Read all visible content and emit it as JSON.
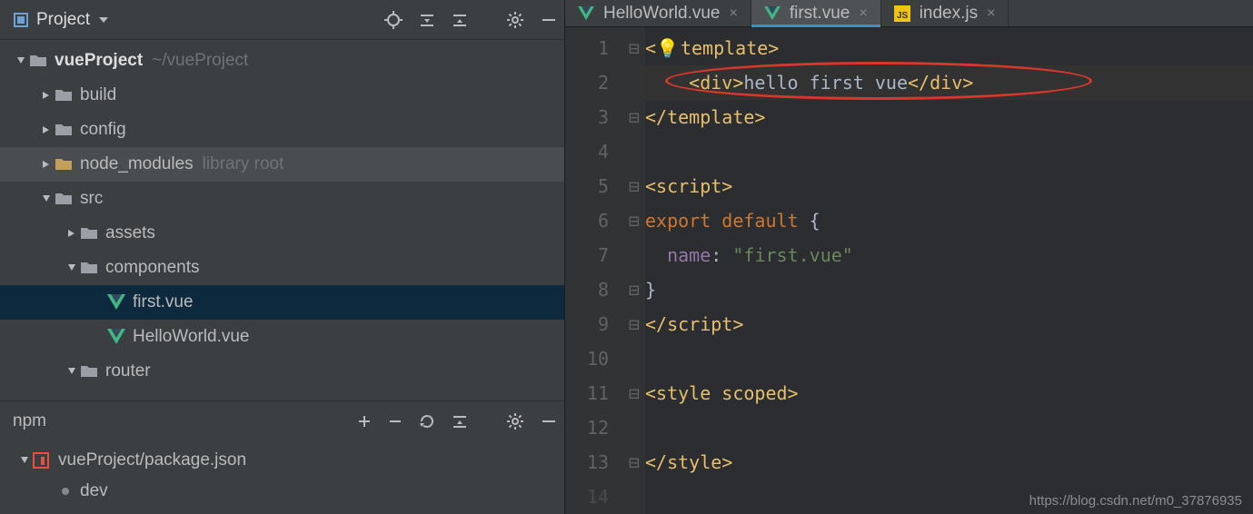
{
  "sidebar": {
    "title": "Project",
    "tree": {
      "root": {
        "name": "vueProject",
        "path": "~/vueProject"
      },
      "build": "build",
      "config": "config",
      "node_modules": {
        "name": "node_modules",
        "hint": "library root"
      },
      "src": "src",
      "assets": "assets",
      "components": "components",
      "first": "first.vue",
      "hello": "HelloWorld.vue",
      "router": "router"
    }
  },
  "npm": {
    "title": "npm",
    "package": "vueProject/package.json",
    "script": "dev"
  },
  "tabs": [
    {
      "label": "HelloWorld.vue",
      "type": "vue",
      "active": false
    },
    {
      "label": "first.vue",
      "type": "vue",
      "active": true
    },
    {
      "label": "index.js",
      "type": "js",
      "active": false
    }
  ],
  "code": {
    "line1": "template",
    "line2_open": "div",
    "line2_text": "hello first vue",
    "line2_close": "div",
    "line3": "template",
    "line5": "script",
    "line6a": "export ",
    "line6b": "default ",
    "line7_key": "name",
    "line7_val": "\"first.vue\"",
    "line9": "script",
    "line11": "style scoped",
    "line13": "style"
  },
  "watermark": "https://blog.csdn.net/m0_37876935"
}
